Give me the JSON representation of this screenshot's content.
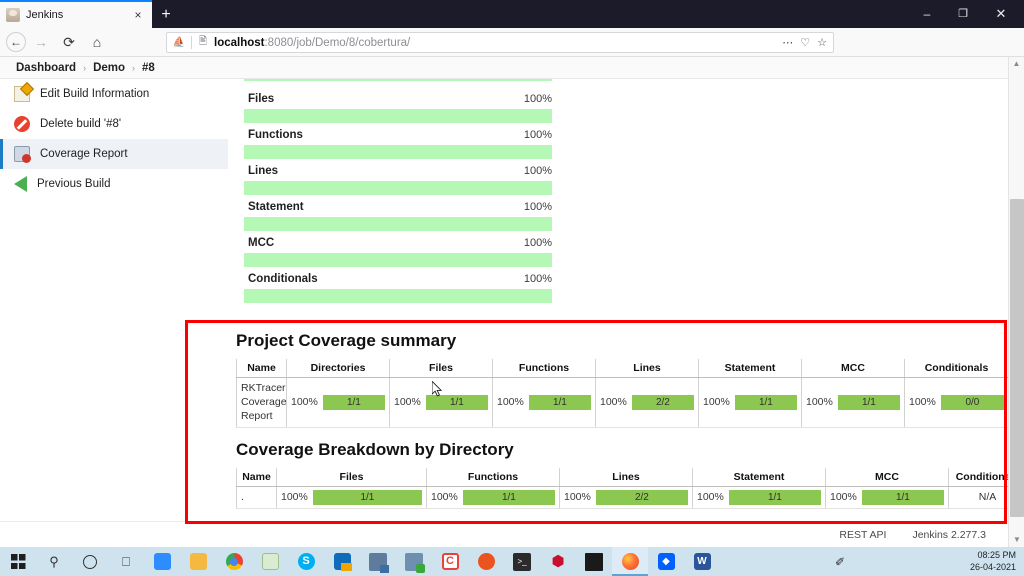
{
  "browser": {
    "tab": {
      "title": "Jenkins",
      "favicon": "jenkins-favicon",
      "close": "×"
    },
    "newtab_label": "+",
    "window_controls": {
      "minimize": "–",
      "maximize": "❐",
      "close": "✕"
    },
    "nav": {
      "back": "←",
      "forward": "→",
      "reload": "⟳",
      "home": "⌂"
    },
    "url": {
      "host": "localhost",
      "rest": ":8080/job/Demo/8/cobertura/",
      "full": "localhost:8080/job/Demo/8/cobertura/"
    },
    "url_actions": {
      "more": "⋯",
      "pocket": "♡",
      "bookmark": "☆"
    },
    "toolbar_right": {
      "library": "▐▐",
      "sidebar": "▤",
      "account": "●",
      "firefox_account": "firefox-account",
      "menu": "≡"
    }
  },
  "breadcrumb": {
    "items": [
      "Dashboard",
      "Demo",
      "#8"
    ],
    "separator": "›"
  },
  "sidebar": {
    "items": [
      {
        "label": "Edit Build Information",
        "icon": "edit-icon",
        "active": false
      },
      {
        "label": "Delete build '#8'",
        "icon": "delete-icon",
        "active": false
      },
      {
        "label": "Coverage Report",
        "icon": "report-icon",
        "active": true
      },
      {
        "label": "Previous Build",
        "icon": "previous-build-icon",
        "active": false
      }
    ]
  },
  "coverage_bars": [
    {
      "label": "Files",
      "percent": "100%",
      "value": 100
    },
    {
      "label": "Functions",
      "percent": "100%",
      "value": 100
    },
    {
      "label": "Lines",
      "percent": "100%",
      "value": 100
    },
    {
      "label": "Statement",
      "percent": "100%",
      "value": 100
    },
    {
      "label": "MCC",
      "percent": "100%",
      "value": 100
    },
    {
      "label": "Conditionals",
      "percent": "100%",
      "value": 100
    }
  ],
  "project_summary": {
    "title": "Project Coverage summary",
    "headers": [
      "Name",
      "Directories",
      "Files",
      "Functions",
      "Lines",
      "Statement",
      "MCC",
      "Conditionals"
    ],
    "rows": [
      {
        "name": "RKTracer Coverage Report",
        "cells": [
          {
            "percent": "100%",
            "ratio": "1/1"
          },
          {
            "percent": "100%",
            "ratio": "1/1"
          },
          {
            "percent": "100%",
            "ratio": "1/1"
          },
          {
            "percent": "100%",
            "ratio": "2/2"
          },
          {
            "percent": "100%",
            "ratio": "1/1"
          },
          {
            "percent": "100%",
            "ratio": "1/1"
          },
          {
            "percent": "100%",
            "ratio": "0/0"
          }
        ]
      }
    ]
  },
  "directory_breakdown": {
    "title": "Coverage Breakdown by Directory",
    "headers": [
      "Name",
      "Files",
      "Functions",
      "Lines",
      "Statement",
      "MCC",
      "Conditionals"
    ],
    "rows": [
      {
        "name": ".",
        "cells": [
          {
            "percent": "100%",
            "ratio": "1/1"
          },
          {
            "percent": "100%",
            "ratio": "1/1"
          },
          {
            "percent": "100%",
            "ratio": "2/2"
          },
          {
            "percent": "100%",
            "ratio": "1/1"
          },
          {
            "percent": "100%",
            "ratio": "1/1"
          }
        ],
        "conditionals": "N/A"
      }
    ]
  },
  "footer": {
    "rest_api": "REST API",
    "version": "Jenkins 2.277.3"
  },
  "scrollbar": {
    "up": "▲",
    "down": "▼"
  },
  "taskbar": {
    "items": [
      {
        "name": "start-button",
        "glyph": ""
      },
      {
        "name": "search-icon",
        "glyph": "⚲"
      },
      {
        "name": "cortana-icon",
        "glyph": "○"
      },
      {
        "name": "task-view-icon",
        "glyph": "⧉"
      },
      {
        "name": "zoom-app-icon",
        "glyph": "▭"
      },
      {
        "name": "file-explorer-icon",
        "glyph": "▱"
      },
      {
        "name": "chrome-icon",
        "glyph": "●"
      },
      {
        "name": "paint-icon",
        "glyph": "✎"
      },
      {
        "name": "skype-icon",
        "glyph": "S"
      },
      {
        "name": "outlook-icon",
        "glyph": "✉"
      },
      {
        "name": "remote-desktop-icon",
        "glyph": "❐"
      },
      {
        "name": "secure-app-icon",
        "glyph": "⚿"
      },
      {
        "name": "clion-icon",
        "glyph": "C"
      },
      {
        "name": "ubuntu-icon",
        "glyph": "●"
      },
      {
        "name": "terminal-icon",
        "glyph": ">_"
      },
      {
        "name": "virtualbox-icon",
        "glyph": "⬢"
      },
      {
        "name": "console-icon",
        "glyph": "▬"
      },
      {
        "name": "firefox-icon",
        "glyph": "●"
      },
      {
        "name": "dropbox-icon",
        "glyph": "◇"
      },
      {
        "name": "word-icon",
        "glyph": "W"
      }
    ],
    "pen_icon": "✐",
    "clock": {
      "time": "08:25 PM",
      "date": "26-04-2021"
    }
  },
  "colors": {
    "bar_light_green": "#b5f7b5",
    "bar_green": "#8cc751",
    "highlight_red": "#fb0000",
    "accent_blue": "#1b7ec4",
    "titlebar": "#1c1b29",
    "taskbar": "#cfe3ef"
  }
}
